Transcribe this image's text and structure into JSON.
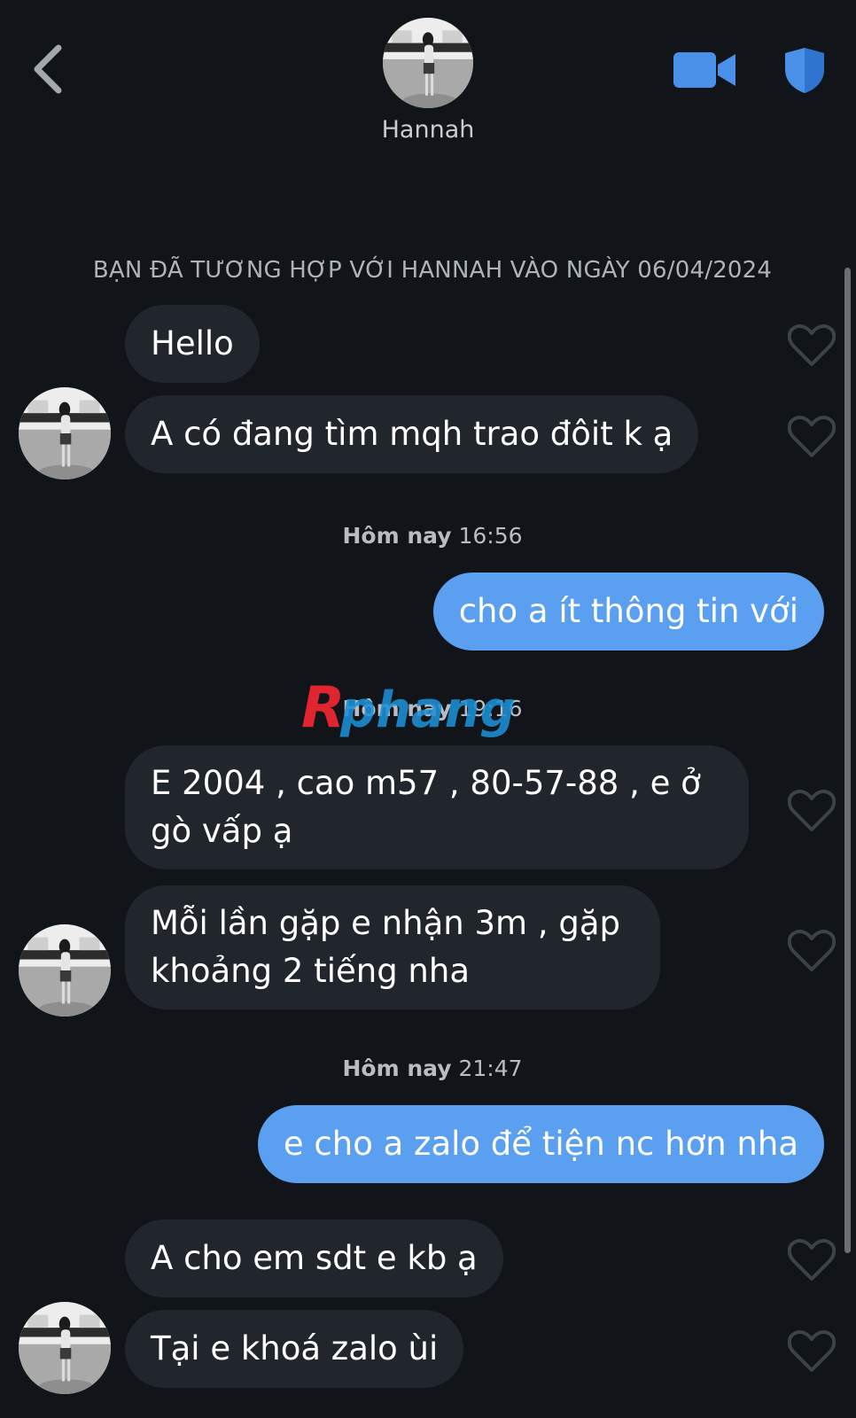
{
  "header": {
    "contact_name": "Hannah",
    "icons": [
      "back-chevron-icon",
      "video-camera-icon",
      "shield-icon"
    ],
    "accent_color": "#4a90e8"
  },
  "timeline": {
    "match_notice": "BẠN ĐÃ TƯƠNG HỢP VỚI HANNAH VÀO NGÀY 06/04/2024",
    "timestamps": [
      {
        "label": "Hôm nay",
        "time": "16:56"
      },
      {
        "label": "Hôm nay",
        "time": "19:16"
      },
      {
        "label": "Hôm nay",
        "time": "21:47"
      }
    ]
  },
  "messages": [
    {
      "from": "Hannah",
      "text": "Hello"
    },
    {
      "from": "Hannah",
      "text": "A có đang tìm mqh trao đôit k ạ"
    },
    {
      "from": "me",
      "text": "cho a ít thông tin với"
    },
    {
      "from": "Hannah",
      "text": "E 2004 , cao m57 , 80-57-88 , e ở gò vấp ạ"
    },
    {
      "from": "Hannah",
      "text": "Mỗi lần gặp e nhận 3m , gặp khoảng 2 tiếng nha"
    },
    {
      "from": "me",
      "text": "e cho a zalo để tiện nc hơn nha"
    },
    {
      "from": "Hannah",
      "text": "A cho em sdt e kb ạ"
    },
    {
      "from": "Hannah",
      "text": "Tại e khoá zalo ùi"
    }
  ],
  "watermark": {
    "text": "Rphang"
  },
  "colors": {
    "background": "#111418",
    "incoming_bubble": "#21262d",
    "outgoing_bubble": "#5a9ff0",
    "muted_text": "#aeb3ba",
    "heart_outline": "#3c4249"
  }
}
